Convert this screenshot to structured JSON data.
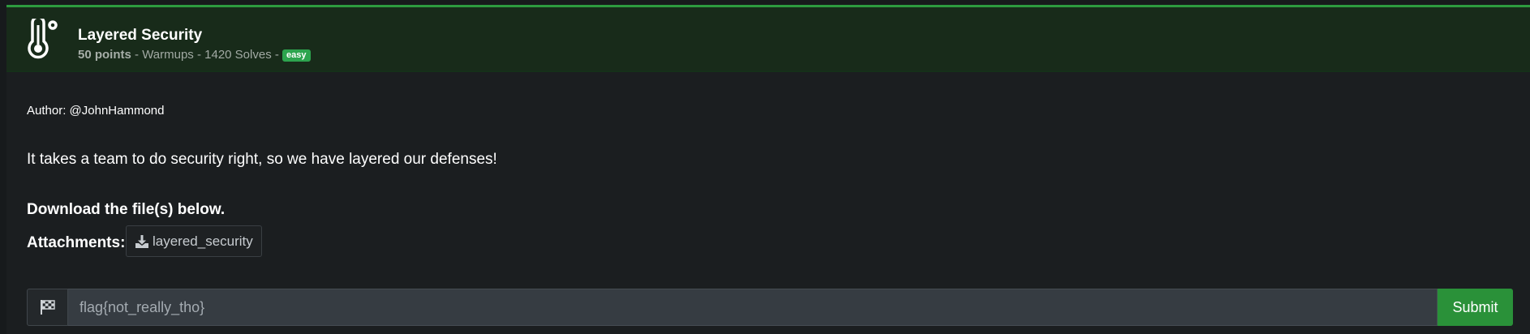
{
  "challenge": {
    "title": "Layered Security",
    "points": "50 points",
    "meta_rest": " - Warmups - 1420 Solves - ",
    "difficulty": "easy",
    "icon": "thermometer-icon"
  },
  "body": {
    "author": "Author: @JohnHammond",
    "description": "It takes a team to do security right, so we have layered our defenses!",
    "download_note": "Download the file(s) below.",
    "attachments_label": "Attachments:",
    "attachments": [
      {
        "name": "layered_security",
        "icon": "download-icon"
      }
    ]
  },
  "flag_form": {
    "prefix_icon": "checkered-flag-icon",
    "placeholder": "flag{not_really_tho}",
    "submit_label": "Submit"
  },
  "colors": {
    "accent": "#2d9a3f",
    "header_bg": "#182b1a",
    "badge": "#2da44e",
    "submit": "#2a9139"
  }
}
